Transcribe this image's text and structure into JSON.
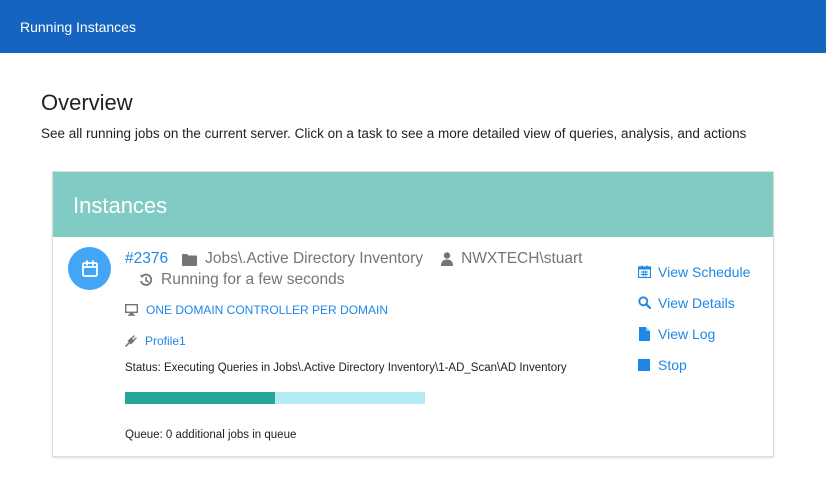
{
  "topbar": {
    "title": "Running Instances"
  },
  "overview": {
    "title": "Overview",
    "description": "See all running jobs on the current server. Click on a task to see a more detailed view of queries, analysis, and actions"
  },
  "instances": {
    "header": "Instances",
    "items": [
      {
        "job_id": "#2376",
        "job_path": "Jobs\\.Active Directory Inventory",
        "user": "NWXTECH\\stuart",
        "running": "Running for a few seconds",
        "scope": "ONE DOMAIN CONTROLLER PER DOMAIN",
        "profile": "Profile1",
        "status": "Status: Executing Queries in Jobs\\.Active Directory Inventory\\1-AD_Scan\\AD Inventory",
        "progress": 0.5,
        "queue": "Queue: 0 additional jobs in queue",
        "actions": {
          "view_schedule": "View Schedule",
          "view_details": "View Details",
          "view_log": "View Log",
          "stop": "Stop"
        }
      }
    ]
  },
  "colors": {
    "topbar": "#1565c0",
    "card_header": "#80cbc4",
    "link": "#1e88e5",
    "progress_fill": "#26a69a",
    "progress_track": "#b2ebf2",
    "calendar_badge": "#42a5f5"
  },
  "icons": {
    "badge": "calendar-icon",
    "job_path": "folder-icon",
    "user": "user-icon",
    "running": "history-icon",
    "scope": "monitor-icon",
    "profile": "plug-icon",
    "view_schedule": "calendar-icon",
    "view_details": "search-icon",
    "view_log": "file-icon",
    "stop": "stop-icon"
  }
}
